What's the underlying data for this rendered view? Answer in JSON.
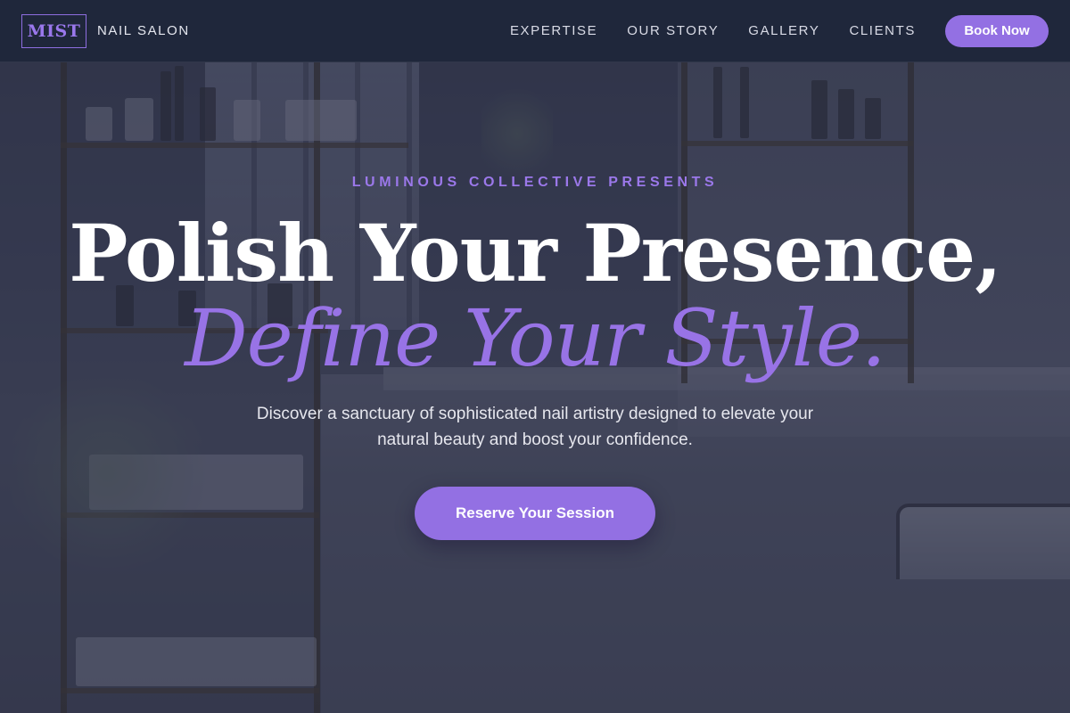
{
  "nav": {
    "logo_text": "MIST",
    "brand_sub": "NAIL SALON",
    "links": [
      "EXPERTISE",
      "OUR STORY",
      "GALLERY",
      "CLIENTS"
    ],
    "cta": "Book Now"
  },
  "hero": {
    "eyebrow": "LUMINOUS COLLECTIVE PRESENTS",
    "headline": "Polish Your Presence,",
    "headline_accent": "Define Your Style.",
    "description": "Discover a sanctuary of sophisticated nail artistry designed to elevate your natural beauty and boost your confidence.",
    "cta": "Reserve Your Session"
  },
  "colors": {
    "accent": "#9370e3",
    "nav_bg": "#1e263a",
    "text": "#ffffff"
  }
}
